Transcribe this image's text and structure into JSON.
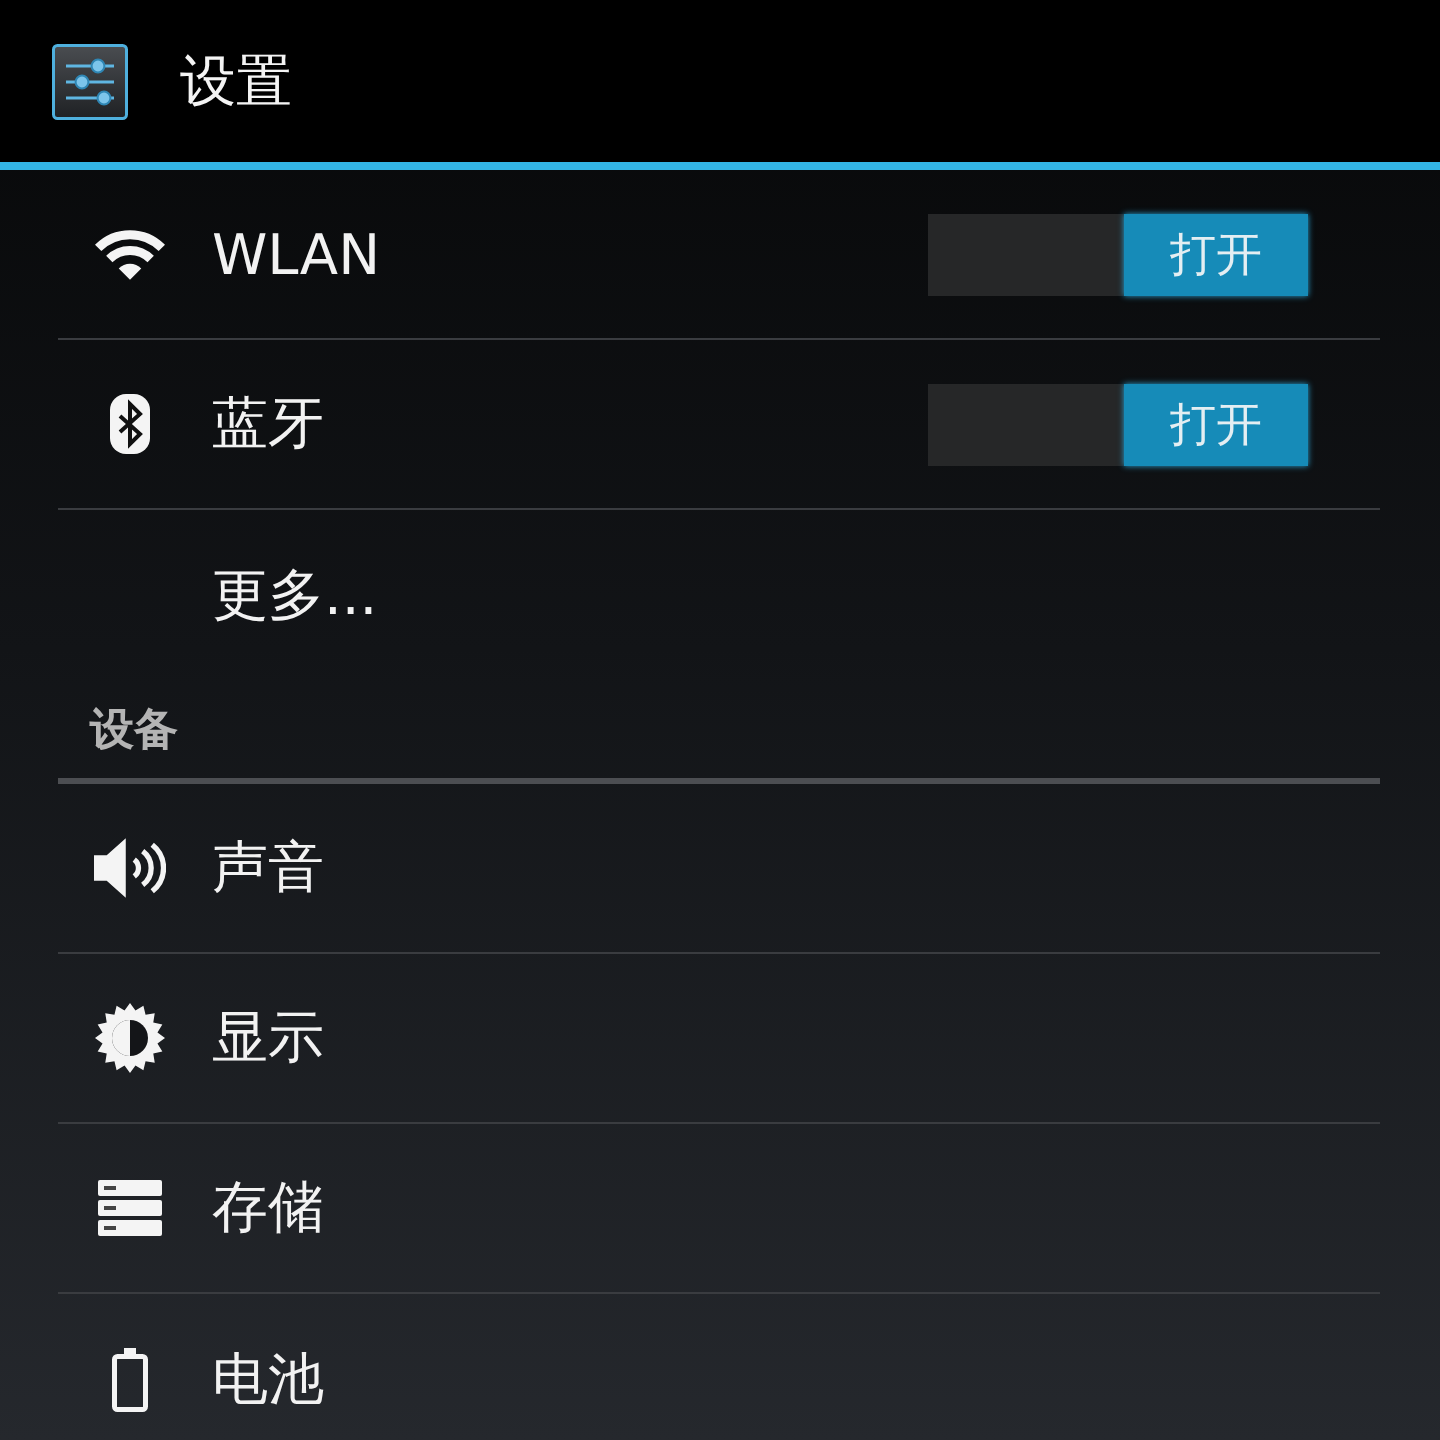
{
  "app_bar": {
    "title": "设置"
  },
  "sections": [
    {
      "items": [
        {
          "kind": "toggle",
          "label": "WLAN",
          "switch": {
            "label": "打开",
            "on": true
          }
        },
        {
          "kind": "toggle",
          "label": "蓝牙",
          "switch": {
            "label": "打开",
            "on": true
          }
        },
        {
          "kind": "plain",
          "label": "更多..."
        }
      ]
    },
    {
      "header": "设备",
      "items": [
        {
          "kind": "plain",
          "label": "声音"
        },
        {
          "kind": "plain",
          "label": "显示"
        },
        {
          "kind": "plain",
          "label": "存储"
        },
        {
          "kind": "plain",
          "label": "电池"
        }
      ]
    }
  ]
}
